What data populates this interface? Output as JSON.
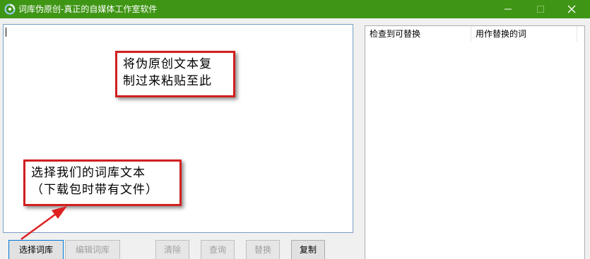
{
  "window": {
    "title": "词库伪原创-真正的自媒体工作室软件",
    "minimize_glyph": "—",
    "maximize_glyph": "☐",
    "close_glyph": "✕"
  },
  "listview": {
    "columns": [
      "检查到可替换",
      "用作替换的词"
    ]
  },
  "callouts": {
    "paste_hint": [
      "将伪原创文本复",
      "制过来粘贴至此"
    ],
    "select_hint": [
      "选择我们的词库文本",
      "（下载包时带有文件）"
    ]
  },
  "buttons": {
    "select_library": "选择词库",
    "edit_library": "编辑词库",
    "clear": "清除",
    "query": "查询",
    "replace": "替换",
    "copy": "复制"
  },
  "colors": {
    "titlebar": "#3f9615",
    "callout_border": "#d21f1f",
    "arrow": "#e02020"
  }
}
